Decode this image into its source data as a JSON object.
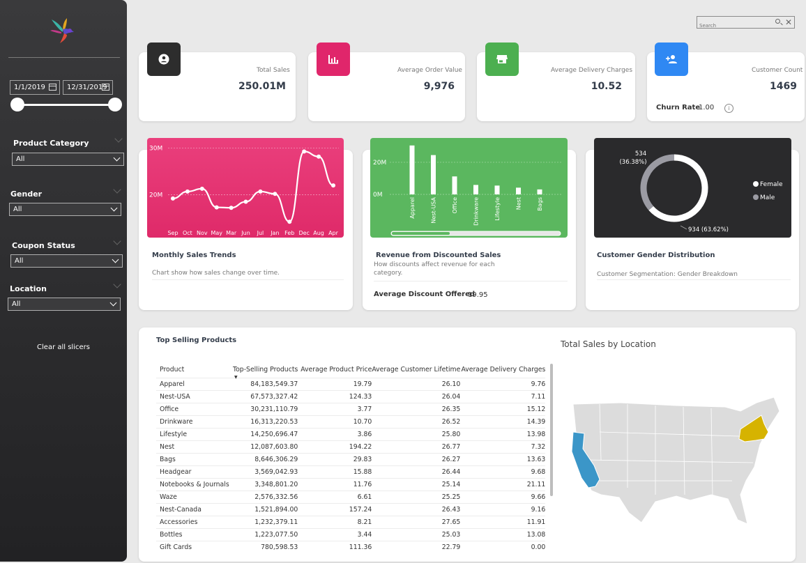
{
  "colors": {
    "sidebar_bg": "#2b2b2d",
    "kpi_total_sales": "#2d2d2d",
    "kpi_avg_order": "#e0266b",
    "kpi_delivery": "#4caf50",
    "kpi_customer": "#2f88f3",
    "sales_trend_bg": "#e4306f",
    "revenue_bg": "#5bb75f",
    "gender_bg": "#2a2a2c",
    "map_california": "#3b96c8",
    "map_newyork": "#d6b300",
    "map_other": "#dcdcdc"
  },
  "sidebar": {
    "date_start": "1/1/2019",
    "date_end": "12/31/2019",
    "filters": [
      {
        "label": "Product Category",
        "value": "All"
      },
      {
        "label": "Gender",
        "value": "All"
      },
      {
        "label": "Coupon Status",
        "value": "All"
      },
      {
        "label": "Location",
        "value": "All"
      }
    ],
    "clear_label": "Clear all slicers"
  },
  "search": {
    "placeholder": "Search"
  },
  "kpis": [
    {
      "label": "Total Sales",
      "value": "250.01M",
      "icon": "user-circle-icon"
    },
    {
      "label": "Average Order Value",
      "value": "9,976",
      "icon": "bar-chart-icon"
    },
    {
      "label": "Average Delivery Charges",
      "value": "10.52",
      "icon": "store-icon"
    },
    {
      "label": "Customer Count",
      "value": "1469",
      "icon": "add-user-icon"
    }
  ],
  "churn": {
    "label": "Churn Rate",
    "value": "1.00"
  },
  "visuals": {
    "sales_trends": {
      "title": "Monthly Sales Trends",
      "subtitle": "Chart show how sales change over time."
    },
    "revenue": {
      "title": "Revenue from Discounted Sales",
      "subtitle": "How discounts affect revenue for each category.",
      "avg_label": "Average Discount Offered",
      "avg_value": "19.95"
    },
    "gender": {
      "title": "Customer Gender Distribution",
      "subtitle": "Customer Segmentation: Gender Breakdown"
    }
  },
  "chart_data": [
    {
      "type": "line",
      "x": [
        "Sep",
        "Oct",
        "Nov",
        "May",
        "Mar",
        "Jun",
        "Jul",
        "Jan",
        "Feb",
        "Dec",
        "Aug",
        "Apr"
      ],
      "values": [
        19.2,
        20.7,
        21.3,
        17.3,
        17.2,
        18.5,
        20.7,
        20.2,
        14.2,
        29.3,
        28.2,
        22.0
      ],
      "ytick_labels": [
        "30M",
        "20M"
      ],
      "ylim": [
        12,
        31
      ]
    },
    {
      "type": "bar",
      "categories": [
        "Apparel",
        "Nest-USA",
        "Office",
        "Drinkware",
        "Lifestyle",
        "Nest",
        "Bags"
      ],
      "values": [
        30.5,
        24.5,
        11.2,
        5.9,
        5.5,
        4.2,
        3.1
      ],
      "ytick_labels": [
        "20M",
        "0M"
      ],
      "ylim": [
        0,
        33
      ]
    },
    {
      "type": "pie",
      "donut": true,
      "slices": [
        {
          "name": "Female",
          "value": 934,
          "label": "934 (63.62%)",
          "color": "#ffffff"
        },
        {
          "name": "Male",
          "value": 534,
          "label": "534 (36.38%)",
          "color": "#9b9ba3"
        }
      ],
      "legend": "right"
    }
  ],
  "table": {
    "title": "Top Selling Products",
    "columns": [
      "Product",
      "Top-Selling Products",
      "Average Product Price",
      "Average Customer Lifetime",
      "Average Delivery Charges"
    ],
    "rows": [
      [
        "Apparel",
        "84,183,549.37",
        "19.79",
        "26.10",
        "9.76"
      ],
      [
        "Nest-USA",
        "67,573,327.42",
        "124.33",
        "26.04",
        "7.11"
      ],
      [
        "Office",
        "30,231,110.79",
        "3.77",
        "26.35",
        "15.12"
      ],
      [
        "Drinkware",
        "16,313,220.53",
        "10.70",
        "26.52",
        "14.39"
      ],
      [
        "Lifestyle",
        "14,250,696.47",
        "3.86",
        "25.80",
        "13.98"
      ],
      [
        "Nest",
        "12,087,603.80",
        "194.22",
        "26.77",
        "7.32"
      ],
      [
        "Bags",
        "8,646,306.29",
        "29.83",
        "26.27",
        "13.63"
      ],
      [
        "Headgear",
        "3,569,042.93",
        "15.88",
        "26.44",
        "9.68"
      ],
      [
        "Notebooks & Journals",
        "3,348,801.20",
        "11.76",
        "25.14",
        "21.11"
      ],
      [
        "Waze",
        "2,576,332.56",
        "6.61",
        "25.25",
        "9.66"
      ],
      [
        "Nest-Canada",
        "1,521,894.00",
        "157.24",
        "26.43",
        "9.16"
      ],
      [
        "Accessories",
        "1,232,379.11",
        "8.21",
        "27.65",
        "11.91"
      ],
      [
        "Bottles",
        "1,223,077.50",
        "3.44",
        "25.03",
        "13.08"
      ],
      [
        "Gift Cards",
        "780,598.53",
        "111.36",
        "22.79",
        "0.00"
      ]
    ]
  },
  "map": {
    "title": "Total Sales by Location"
  }
}
